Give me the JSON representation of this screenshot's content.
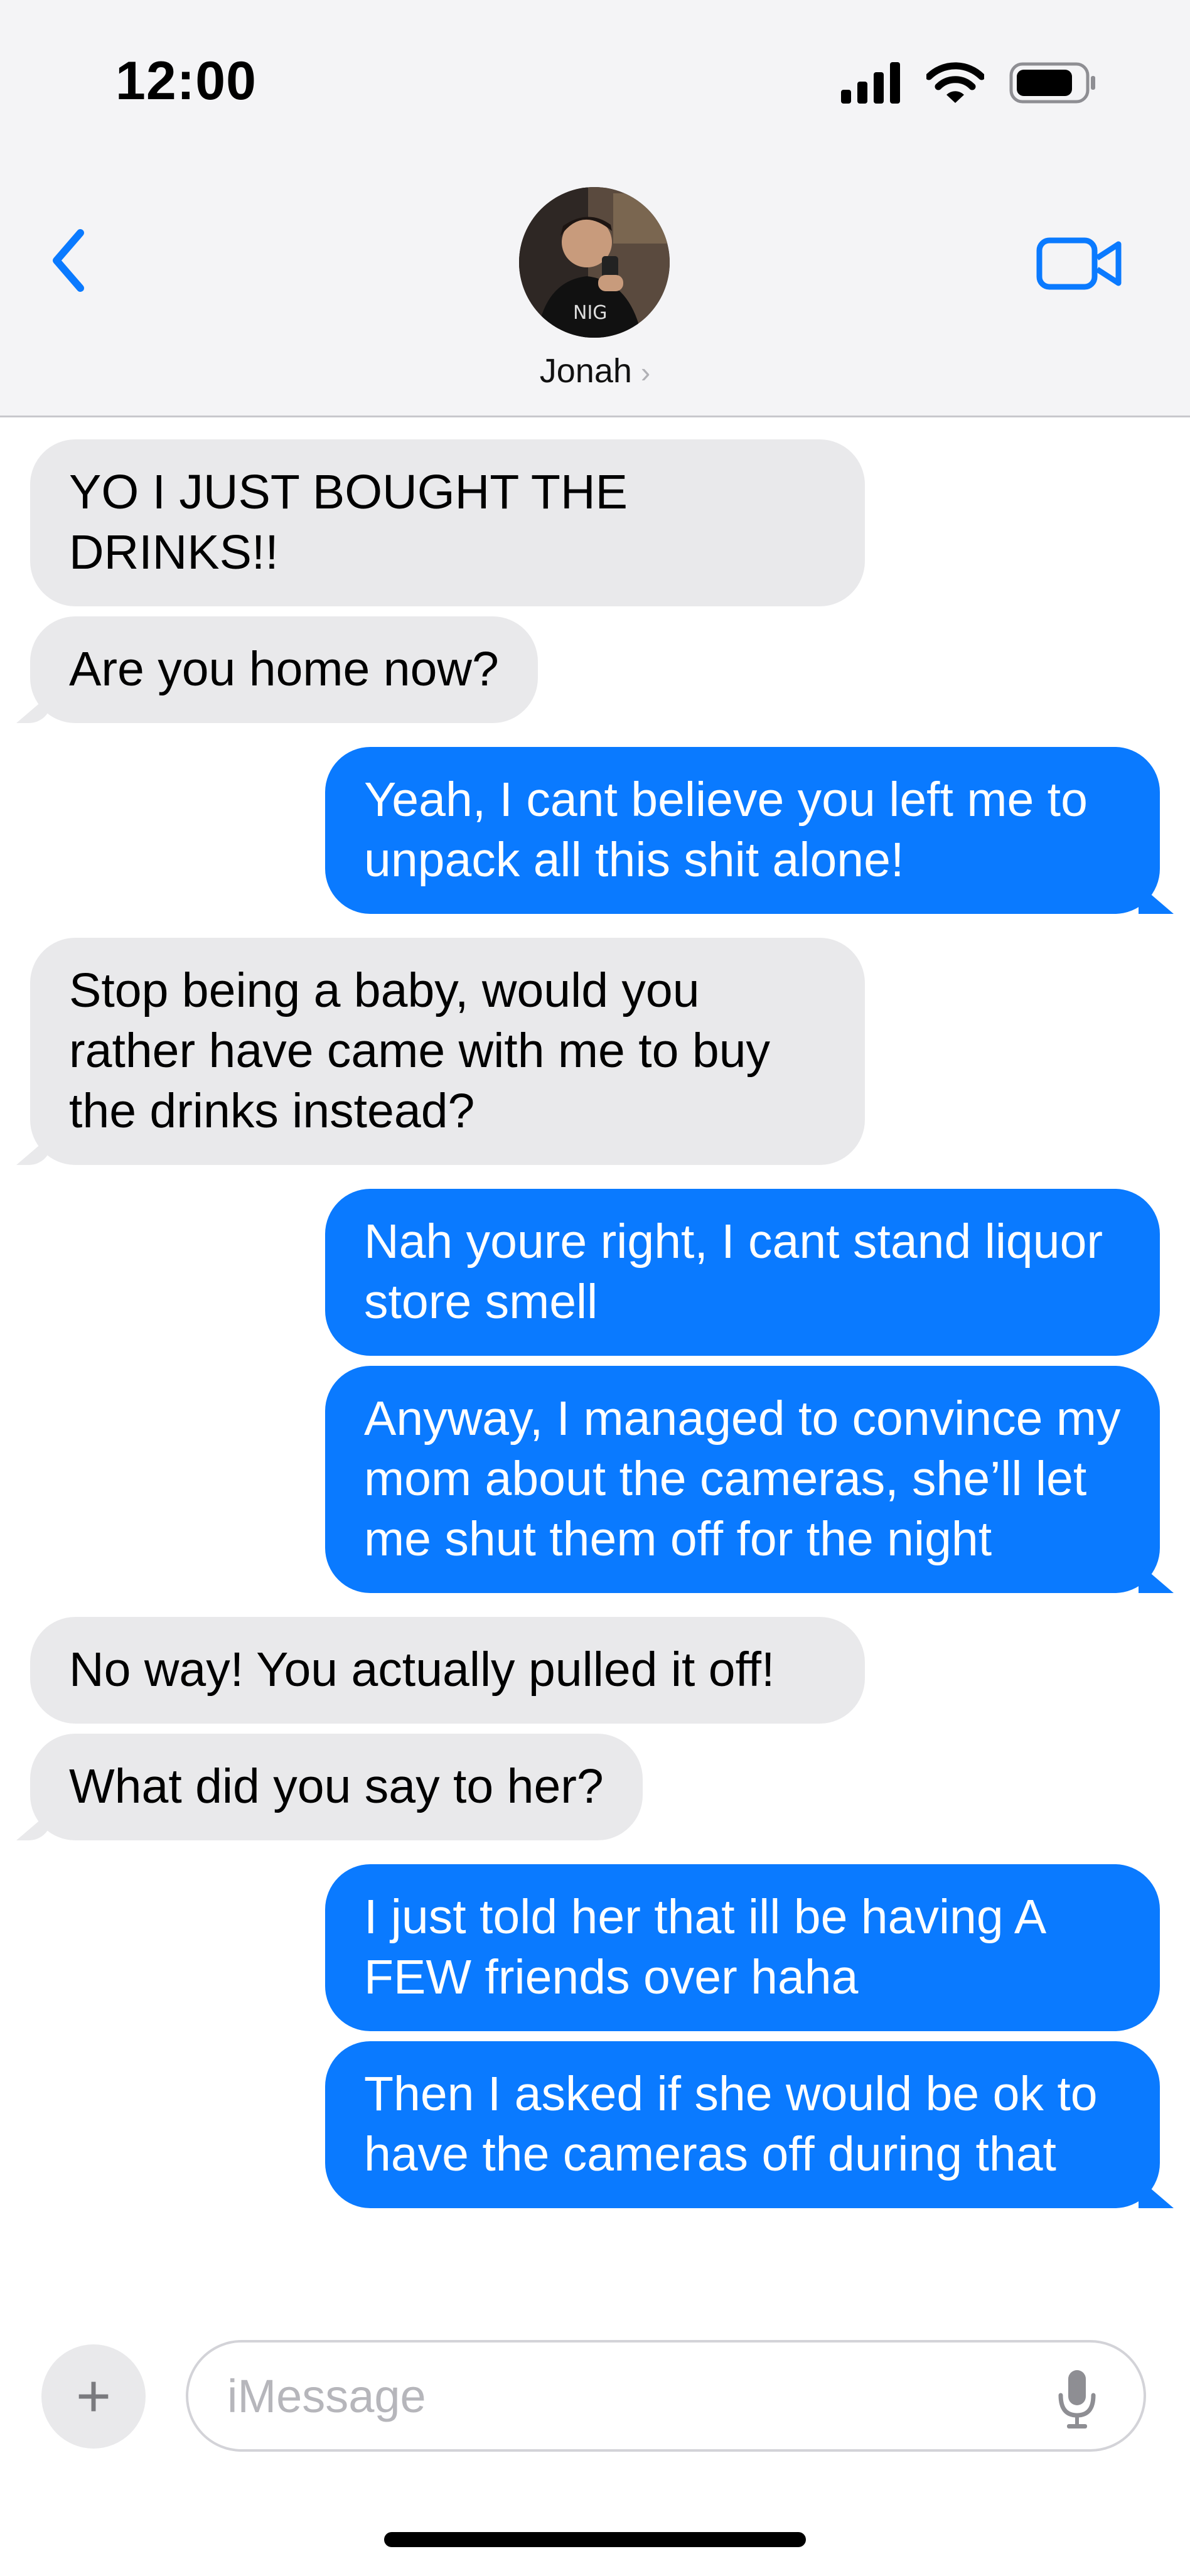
{
  "status_bar": {
    "time": "12:00"
  },
  "header": {
    "contact_name": "Jonah",
    "contact_chevron": "›"
  },
  "icons": {
    "back": "chevron-left-icon",
    "video": "video-camera-icon",
    "signal": "cellular-signal-icon",
    "wifi": "wifi-icon",
    "battery": "battery-icon",
    "add": "plus-icon",
    "mic": "microphone-icon"
  },
  "colors": {
    "accent": "#0a7aff",
    "incoming_bubble": "#e9e9eb"
  },
  "messages": [
    {
      "from": "them",
      "text": "YO I JUST BOUGHT THE DRINKS!!"
    },
    {
      "from": "them",
      "text": "Are you home now?"
    },
    {
      "from": "me",
      "text": "Yeah, I cant believe you left me to unpack all this shit alone!"
    },
    {
      "from": "them",
      "text": "Stop being a baby, would you rather have came with me to buy the drinks instead?"
    },
    {
      "from": "me",
      "text": "Nah youre right, I cant stand liquor store smell"
    },
    {
      "from": "me",
      "text": "Anyway, I managed to convince my mom about the cameras, she’ll let me shut them off for the night"
    },
    {
      "from": "them",
      "text": "No way! You actually pulled it off!"
    },
    {
      "from": "them",
      "text": "What did you say to her?"
    },
    {
      "from": "me",
      "text": "I just told her that ill be having A FEW friends over haha"
    },
    {
      "from": "me",
      "text": "Then I asked if she would be ok to have the cameras off during that"
    }
  ],
  "composer": {
    "plus_label": "+",
    "placeholder": "iMessage"
  }
}
